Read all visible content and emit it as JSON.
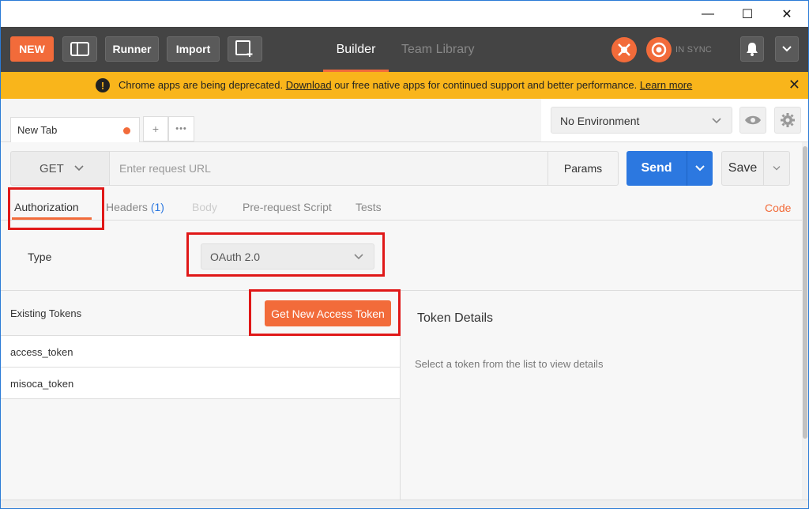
{
  "window": {
    "minimize": "—",
    "maximize": "☐",
    "close": "✕"
  },
  "header": {
    "new_label": "NEW",
    "runner_label": "Runner",
    "import_label": "Import",
    "tabs": [
      {
        "label": "Builder",
        "active": true
      },
      {
        "label": "Team Library",
        "active": false
      }
    ],
    "sync_status": "IN SYNC",
    "accent": "#f26b3a",
    "background": "#444444"
  },
  "banner": {
    "text_before": "Chrome apps are being deprecated. ",
    "download_link": "Download",
    "text_after": " our free native apps for continued support and better performance. ",
    "learn_more": "Learn more",
    "close": "✕",
    "color": "#f9b51b"
  },
  "tabs": {
    "request_tab": "New Tab",
    "add": "+",
    "more": "•••"
  },
  "environment": {
    "selected": "No Environment"
  },
  "request": {
    "method": "GET",
    "url_placeholder": "Enter request URL",
    "params_label": "Params",
    "send_label": "Send",
    "save_label": "Save",
    "send_color": "#2c78e0"
  },
  "subtabs": {
    "items": [
      {
        "label": "Authorization",
        "active": true
      },
      {
        "label": "Headers",
        "count": "(1)"
      },
      {
        "label": "Body",
        "disabled": true
      },
      {
        "label": "Pre-request Script"
      },
      {
        "label": "Tests"
      }
    ],
    "code_link": "Code"
  },
  "auth": {
    "type_label": "Type",
    "type_value": "OAuth 2.0"
  },
  "tokens": {
    "title": "Existing Tokens",
    "get_new_label": "Get New Access Token",
    "items": [
      "access_token",
      "misoca_token"
    ],
    "details_title": "Token Details",
    "details_hint": "Select a token from the list to view details"
  }
}
